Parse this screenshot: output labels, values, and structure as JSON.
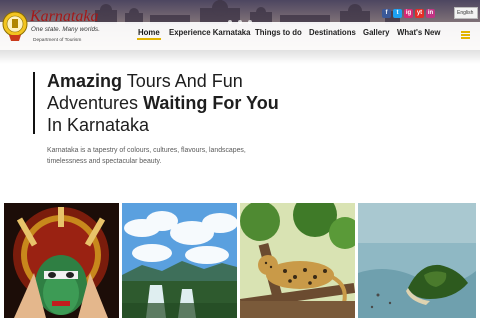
{
  "header": {
    "brand": "Karnataka",
    "tagline": "One state. Many worlds.",
    "department": "Department of Tourism",
    "language": "English",
    "social": [
      "f",
      "t",
      "ig",
      "yt",
      "in"
    ]
  },
  "nav": {
    "items": [
      "Home",
      "Experience Karnataka",
      "Things to do",
      "Destinations",
      "Gallery",
      "What's New"
    ],
    "active": "Home"
  },
  "hero": {
    "line1_bold": "Amazing",
    "line1_rest": " Tours And Fun",
    "line2_plain": "Adventures ",
    "line2_bold": "Waiting For You",
    "line3": "In Karnataka",
    "description": "Karnataka is a tapestry of colours, cultures, flavours, landscapes, timelessness and spectacular beauty."
  },
  "colors": {
    "accent": "#e2b400",
    "brand_red": "#a41818"
  },
  "cards": [
    "kathakali-dancer-image",
    "waterfall-image",
    "leopard-image",
    "island-aerial-image"
  ]
}
